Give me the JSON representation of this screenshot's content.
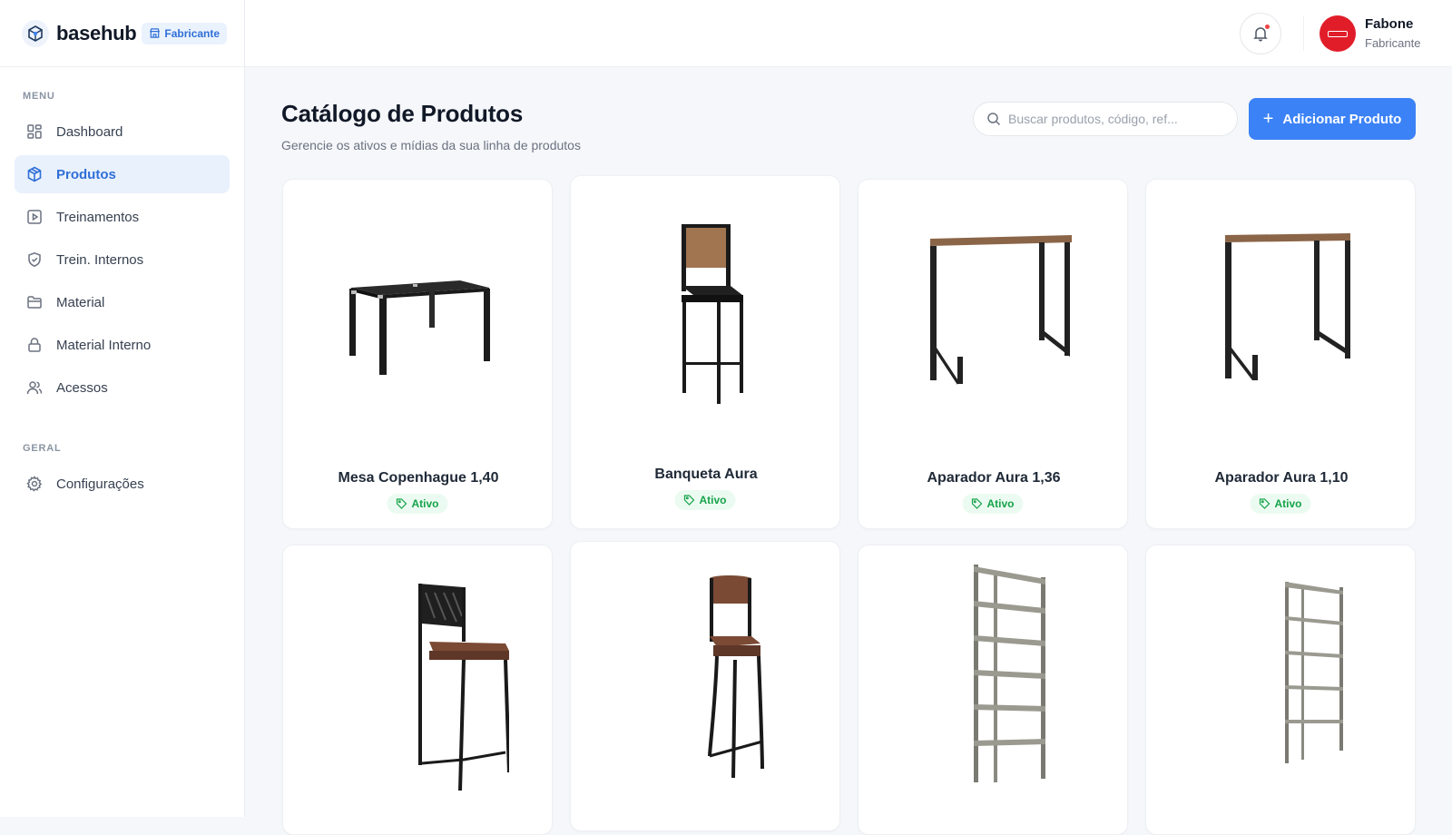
{
  "brand": {
    "name": "basehub",
    "badge": "Fabricante"
  },
  "sidebar": {
    "menu_label": "MENU",
    "items": [
      {
        "label": "Dashboard",
        "icon": "dashboard-icon"
      },
      {
        "label": "Produtos",
        "icon": "box-icon",
        "active": true
      },
      {
        "label": "Treinamentos",
        "icon": "play-icon"
      },
      {
        "label": "Trein. Internos",
        "icon": "shield-icon"
      },
      {
        "label": "Material",
        "icon": "folder-icon"
      },
      {
        "label": "Material Interno",
        "icon": "lock-icon"
      },
      {
        "label": "Acessos",
        "icon": "users-icon"
      }
    ],
    "general_label": "GERAL",
    "general_items": [
      {
        "label": "Configurações",
        "icon": "gear-icon"
      }
    ]
  },
  "header": {
    "user": {
      "name": "Fabone",
      "role": "Fabricante"
    }
  },
  "main": {
    "title": "Catálogo de Produtos",
    "subtitle": "Gerencie os ativos e mídias da sua linha de produtos",
    "search": {
      "placeholder": "Buscar produtos, código, ref..."
    },
    "add_button": "Adicionar Produto",
    "products": [
      {
        "name": "Mesa Copenhague 1,40",
        "status": "Ativo",
        "image": "table"
      },
      {
        "name": "Banqueta Aura",
        "status": "Ativo",
        "image": "stool-wood"
      },
      {
        "name": "Aparador Aura 1,36",
        "status": "Ativo",
        "image": "console-wide"
      },
      {
        "name": "Aparador Aura 1,10",
        "status": "Ativo",
        "image": "console-narrow"
      },
      {
        "name": "",
        "status": "",
        "image": "stool-black"
      },
      {
        "name": "",
        "status": "",
        "image": "stool-brown"
      },
      {
        "name": "",
        "status": "",
        "image": "shelf-tall"
      },
      {
        "name": "",
        "status": "",
        "image": "shelf-narrow"
      }
    ]
  },
  "colors": {
    "accent": "#3b82f6",
    "active_bg": "#e9f1fd",
    "status_green": "#16a34a",
    "avatar_red": "#e11d2a"
  }
}
